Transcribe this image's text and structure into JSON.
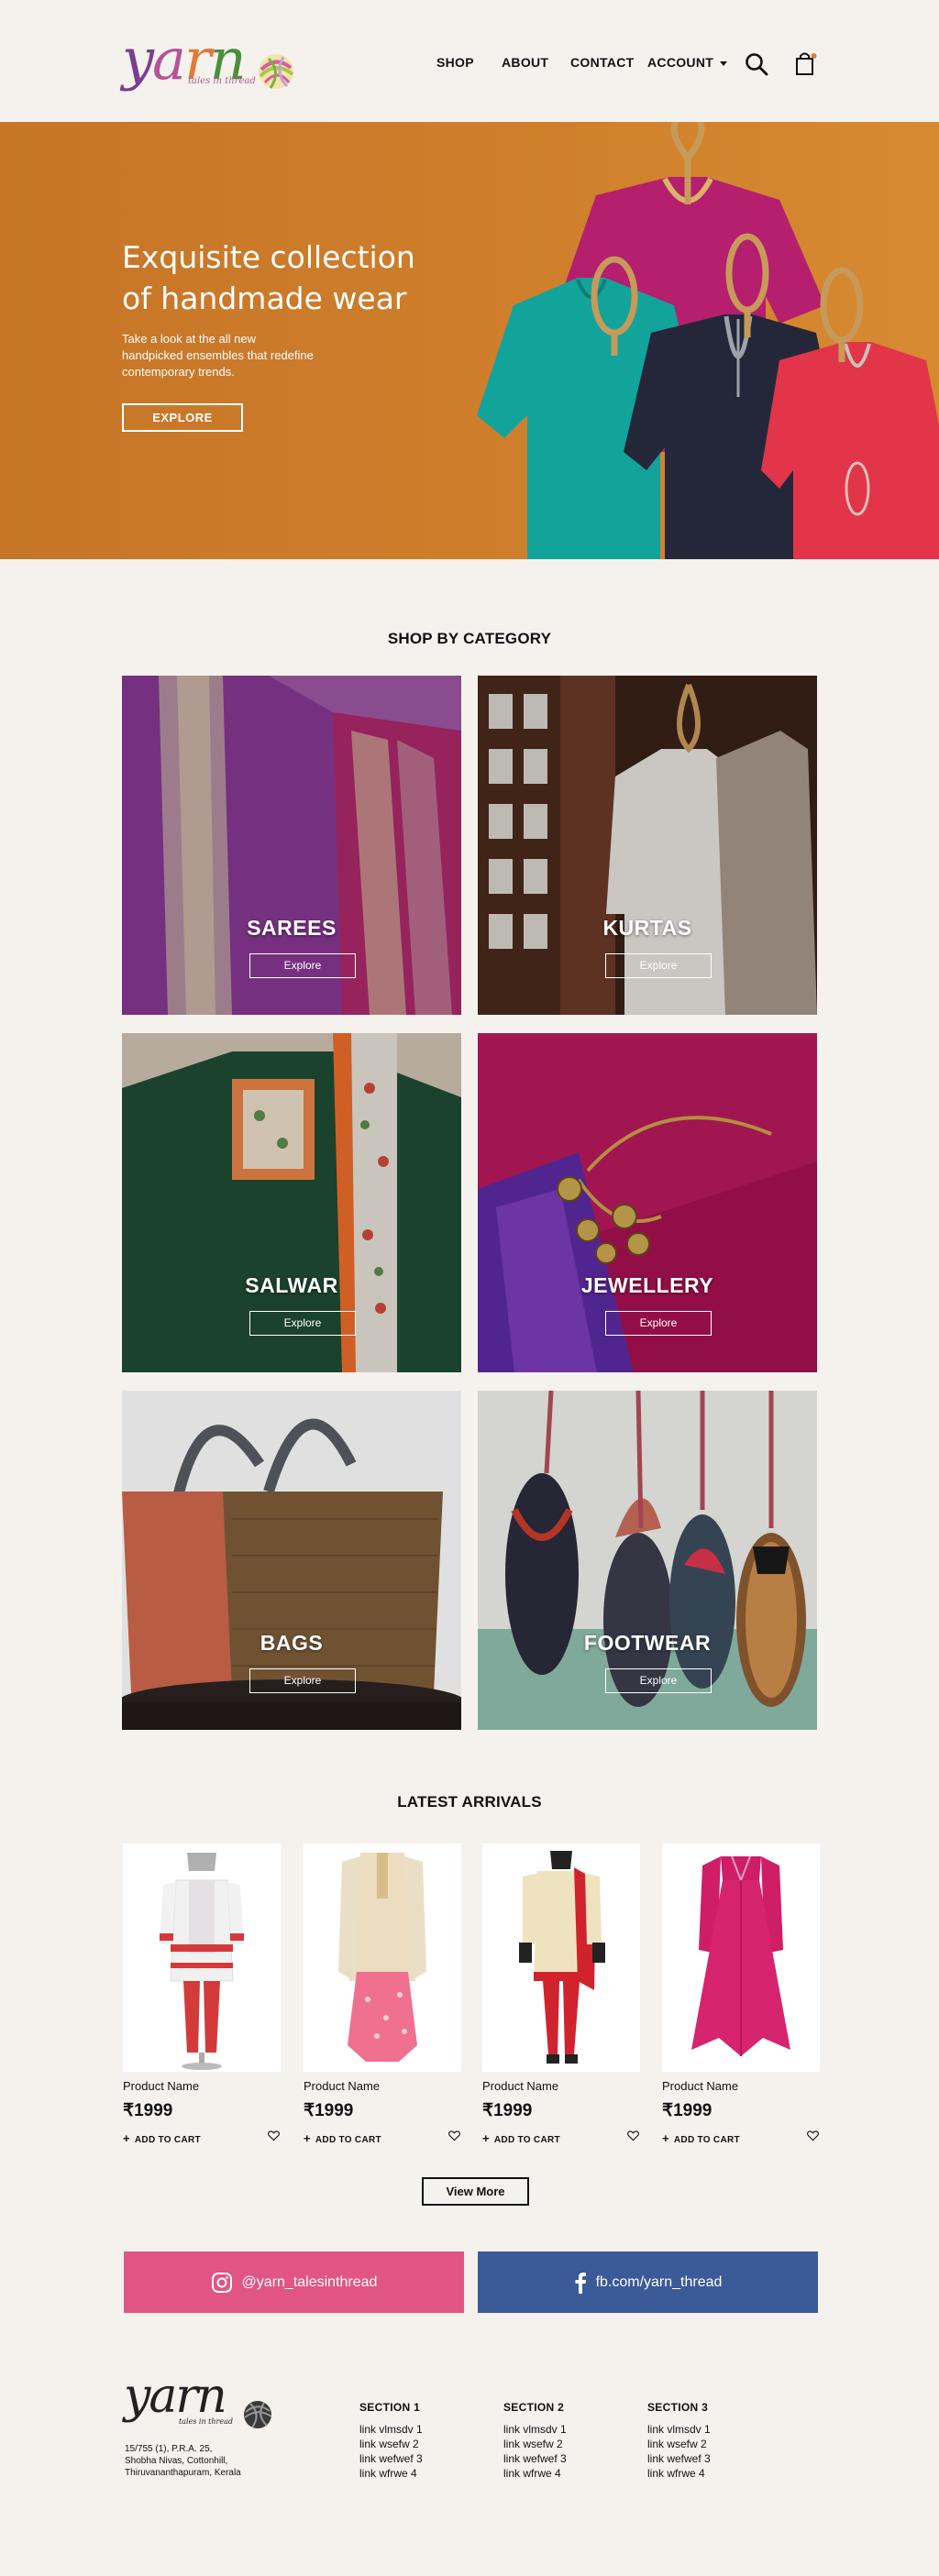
{
  "header": {
    "logo_text": "yarn",
    "logo_tagline": "tales in thread",
    "nav": [
      "SHOP",
      "ABOUT",
      "CONTACT",
      "ACCOUNT"
    ]
  },
  "hero": {
    "title": "Exquisite collection of handmade wear",
    "subtitle": "Take a look at the all new handpicked ensembles that redefine contemporary trends.",
    "button": "EXPLORE"
  },
  "categories": {
    "title": "SHOP BY CATEGORY",
    "items": [
      {
        "label": "SAREES",
        "button": "Explore"
      },
      {
        "label": "KURTAS",
        "button": "Explore"
      },
      {
        "label": "SALWAR",
        "button": "Explore"
      },
      {
        "label": "JEWELLERY",
        "button": "Explore"
      },
      {
        "label": "BAGS",
        "button": "Explore"
      },
      {
        "label": "FOOTWEAR",
        "button": "Explore"
      }
    ]
  },
  "latest": {
    "title": "LATEST ARRIVALS",
    "products": [
      {
        "name": "Product Name",
        "price": "₹1999",
        "add": "ADD TO CART"
      },
      {
        "name": "Product Name",
        "price": "₹1999",
        "add": "ADD TO CART"
      },
      {
        "name": "Product Name",
        "price": "₹1999",
        "add": "ADD TO CART"
      },
      {
        "name": "Product Name",
        "price": "₹1999",
        "add": "ADD TO CART"
      }
    ],
    "view_more": "View More"
  },
  "social": {
    "instagram": "@yarn_talesinthread",
    "facebook": "fb.com/yarn_thread"
  },
  "footer": {
    "logo_text": "yarn",
    "logo_tagline": "tales in thread",
    "address": [
      "15/755 (1), P.R.A. 25,",
      "Shobha Nivas, Cottonhill,",
      "Thiruvananthapuram, Kerala"
    ],
    "sections": [
      {
        "title": "SECTION 1",
        "links": [
          "link vlmsdv 1",
          "link wsefw 2",
          "link wefwef 3",
          "link wfrwe 4"
        ]
      },
      {
        "title": "SECTION 2",
        "links": [
          "link vlmsdv 1",
          "link wsefw 2",
          "link wefwef 3",
          "link wfrwe 4"
        ]
      },
      {
        "title": "SECTION 3",
        "links": [
          "link vlmsdv 1",
          "link wsefw 2",
          "link wefwef 3",
          "link wfrwe 4"
        ]
      }
    ]
  },
  "colors": {
    "background": "#f5f2ee",
    "hero_orange": "#cf7f2b",
    "instagram_pink": "#e05584",
    "facebook_blue": "#3b5a98"
  },
  "icons": [
    "search-icon",
    "cart-icon",
    "chevron-down-icon",
    "heart-icon",
    "plus-icon",
    "instagram-icon",
    "facebook-icon",
    "yarn-ball-icon"
  ]
}
